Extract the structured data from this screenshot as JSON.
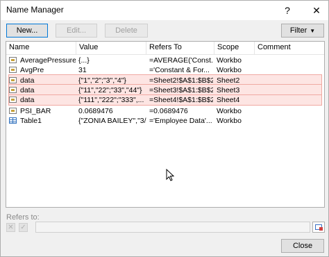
{
  "window": {
    "title": "Name Manager",
    "help_label": "?",
    "close_label": "✕"
  },
  "toolbar": {
    "new_label": "New...",
    "edit_label": "Edit...",
    "delete_label": "Delete",
    "filter_label": "Filter",
    "filter_arrow": "▼"
  },
  "table": {
    "headers": {
      "name": "Name",
      "value": "Value",
      "refers_to": "Refers To",
      "scope": "Scope",
      "comment": "Comment"
    },
    "rows": [
      {
        "icon": "name-icon",
        "name": "AveragePressure",
        "value": "{...}",
        "refers_to": "=AVERAGE('Const...",
        "scope": "Workbo",
        "comment": ""
      },
      {
        "icon": "name-icon",
        "name": "AvgPre",
        "value": "31",
        "refers_to": "='Constant & For...",
        "scope": "Workbo",
        "comment": ""
      },
      {
        "icon": "name-icon",
        "name": "data",
        "value": "{\"1\",\"2\";\"3\",\"4\"}",
        "refers_to": "=Sheet2!$A$1:$B$2",
        "scope": "Sheet2",
        "comment": ""
      },
      {
        "icon": "name-icon",
        "name": "data",
        "value": "{\"11\",\"22\";\"33\",\"44\"}",
        "refers_to": "=Sheet3!$A$1:$B$2",
        "scope": "Sheet3",
        "comment": ""
      },
      {
        "icon": "name-icon",
        "name": "data",
        "value": "{\"111\",\"222\";\"333\",...",
        "refers_to": "=Sheet4!$A$1:$B$2",
        "scope": "Sheet4",
        "comment": ""
      },
      {
        "icon": "name-icon",
        "name": "PSI_BAR",
        "value": "0.0689476",
        "refers_to": "=0.0689476",
        "scope": "Workbo",
        "comment": ""
      },
      {
        "icon": "table-icon",
        "name": "Table1",
        "value": "{\"ZONIA BAILEY\",\"3/...",
        "refers_to": "='Employee Data'...",
        "scope": "Workbo",
        "comment": ""
      }
    ],
    "highlight_color": "#fde5e3"
  },
  "refers_to": {
    "label": "Refers to:",
    "value": ""
  },
  "footer": {
    "close_label": "Close"
  },
  "colors": {
    "accent": "#0078d7",
    "highlight_border": "#f0a9a2"
  }
}
